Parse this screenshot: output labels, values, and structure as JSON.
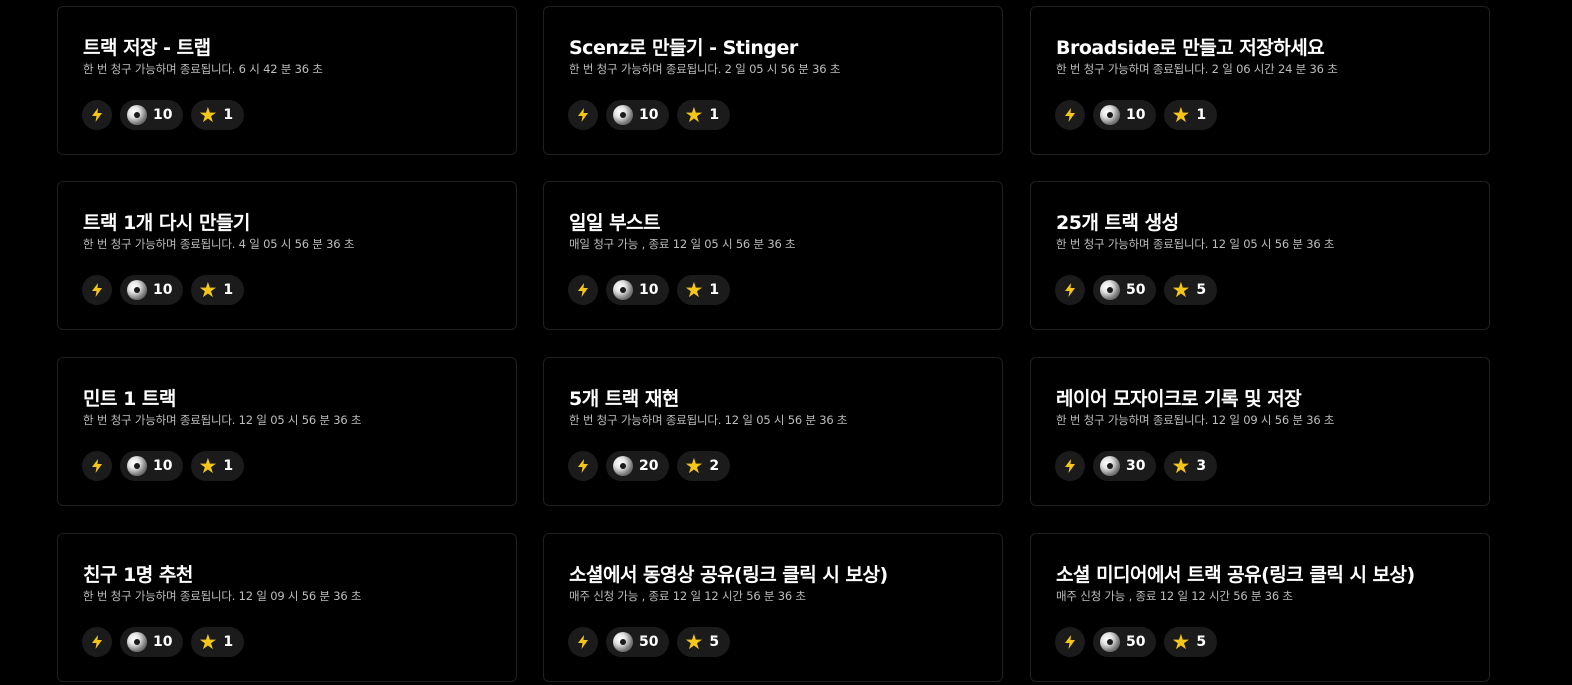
{
  "colors": {
    "background": "#000000",
    "card_border": "#1f1f1f",
    "chip_background": "#1b1b1b",
    "bolt": "#f5c518",
    "star": "#f5c518",
    "subtitle": "#bdbdbd"
  },
  "icons": {
    "bolt": "lightning-bolt-icon",
    "points": "disc-token-icon",
    "star": "star-icon"
  },
  "quests": [
    {
      "title": "트랙 저장 - 트랩",
      "subtitle": "한 번 청구 가능하며 종료됩니다. 6 시 42 분 36 초",
      "points": "10",
      "stars": "1"
    },
    {
      "title": "Scenz로 만들기 - Stinger",
      "subtitle": "한 번 청구 가능하며 종료됩니다. 2 일 05 시 56 분 36 초",
      "points": "10",
      "stars": "1"
    },
    {
      "title": "Broadside로 만들고 저장하세요",
      "subtitle": "한 번 청구 가능하며 종료됩니다. 2 일 06 시간 24 분 36 초",
      "points": "10",
      "stars": "1"
    },
    {
      "title": "트랙 1개 다시 만들기",
      "subtitle": "한 번 청구 가능하며 종료됩니다. 4 일 05 시 56 분 36 초",
      "points": "10",
      "stars": "1"
    },
    {
      "title": "일일 부스트",
      "subtitle": "매일 청구 가능 , 종료 12 일 05 시 56 분 36 초",
      "points": "10",
      "stars": "1"
    },
    {
      "title": "25개 트랙 생성",
      "subtitle": "한 번 청구 가능하며 종료됩니다. 12 일 05 시 56 분 36 초",
      "points": "50",
      "stars": "5"
    },
    {
      "title": "민트 1 트랙",
      "subtitle": "한 번 청구 가능하며 종료됩니다. 12 일 05 시 56 분 36 초",
      "points": "10",
      "stars": "1"
    },
    {
      "title": "5개 트랙 재현",
      "subtitle": "한 번 청구 가능하며 종료됩니다. 12 일 05 시 56 분 36 초",
      "points": "20",
      "stars": "2"
    },
    {
      "title": "레이어 모자이크로 기록 및 저장",
      "subtitle": "한 번 청구 가능하며 종료됩니다. 12 일 09 시 56 분 36 초",
      "points": "30",
      "stars": "3"
    },
    {
      "title": "친구 1명 추천",
      "subtitle": "한 번 청구 가능하며 종료됩니다. 12 일 09 시 56 분 36 초",
      "points": "10",
      "stars": "1"
    },
    {
      "title": "소셜에서 동영상 공유(링크 클릭 시 보상)",
      "subtitle": "매주 신청 가능 , 종료 12 일 12 시간 56 분 36 초",
      "points": "50",
      "stars": "5"
    },
    {
      "title": "소셜 미디어에서 트랙 공유(링크 클릭 시 보상)",
      "subtitle": "매주 신청 가능 , 종료 12 일 12 시간 56 분 36 초",
      "points": "50",
      "stars": "5"
    }
  ]
}
